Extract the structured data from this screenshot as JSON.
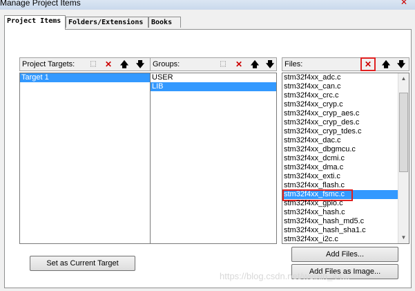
{
  "window": {
    "title": "Manage Project Items",
    "close_glyph": "✕"
  },
  "tabs": [
    {
      "label": "Project Items"
    },
    {
      "label": "Folders/Extensions"
    },
    {
      "label": "Books"
    }
  ],
  "targets": {
    "header": "Project Targets:",
    "items": [
      "Target 1"
    ],
    "selected": "Target 1"
  },
  "groups": {
    "header": "Groups:",
    "items": [
      "USER",
      "LIB"
    ],
    "selected": "LIB"
  },
  "files": {
    "header": "Files:",
    "items": [
      "stm32f4xx_adc.c",
      "stm32f4xx_can.c",
      "stm32f4xx_crc.c",
      "stm32f4xx_cryp.c",
      "stm32f4xx_cryp_aes.c",
      "stm32f4xx_cryp_des.c",
      "stm32f4xx_cryp_tdes.c",
      "stm32f4xx_dac.c",
      "stm32f4xx_dbgmcu.c",
      "stm32f4xx_dcmi.c",
      "stm32f4xx_dma.c",
      "stm32f4xx_exti.c",
      "stm32f4xx_flash.c",
      "stm32f4xx_fsmc.c",
      "stm32f4xx_gpio.c",
      "stm32f4xx_hash.c",
      "stm32f4xx_hash_md5.c",
      "stm32f4xx_hash_sha1.c",
      "stm32f4xx_i2c.c"
    ],
    "selected": "stm32f4xx_fsmc.c"
  },
  "toolbar": {
    "new_glyph": "⬚",
    "delete_glyph": "✕",
    "up_glyph": "🡅",
    "down_glyph": "🡇"
  },
  "buttons": {
    "set_current_target": "Set as Current Target",
    "add_files": "Add Files...",
    "add_files_as_image": "Add Files as Image..."
  },
  "watermark": "https://blog.csdn.net/weixin_44..."
}
